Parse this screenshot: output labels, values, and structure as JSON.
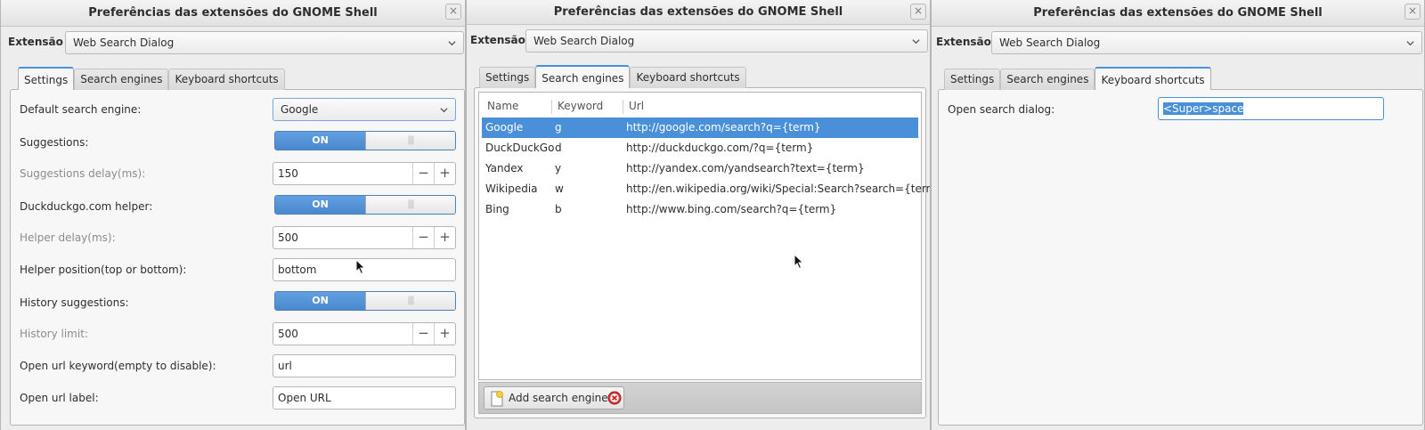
{
  "window": {
    "title": "Preferências das extensões do GNOME Shell",
    "close_glyph": "×",
    "extension_label": "Extensão",
    "extension_value": "Web Search Dialog"
  },
  "tabs": {
    "settings": "Settings",
    "search_engines": "Search engines",
    "keyboard_shortcuts": "Keyboard shortcuts"
  },
  "settings": {
    "default_engine": {
      "label": "Default search engine:",
      "value": "Google"
    },
    "suggestions": {
      "label": "Suggestions:",
      "state": "ON"
    },
    "suggestions_delay": {
      "label": "Suggestions delay(ms):",
      "value": "150"
    },
    "ddg_helper": {
      "label": "Duckduckgo.com helper:",
      "state": "ON"
    },
    "helper_delay": {
      "label": "Helper delay(ms):",
      "value": "500"
    },
    "helper_position": {
      "label": "Helper position(top or bottom):",
      "value": "bottom"
    },
    "history_suggestions": {
      "label": "History suggestions:",
      "state": "ON"
    },
    "history_limit": {
      "label": "History limit:",
      "value": "500"
    },
    "open_url_keyword": {
      "label": "Open url keyword(empty to disable):",
      "value": "url"
    },
    "open_url_label": {
      "label": "Open url label:",
      "value": "Open URL"
    },
    "switch_knob_glyph": "|||",
    "spin_minus": "−",
    "spin_plus": "+"
  },
  "engines": {
    "columns": {
      "name": "Name",
      "keyword": "Keyword",
      "url": "Url"
    },
    "rows": [
      {
        "name": "Google",
        "keyword": "g",
        "url": "http://google.com/search?q={term}"
      },
      {
        "name": "DuckDuckGo",
        "keyword": "d",
        "url": "http://duckduckgo.com/?q={term}"
      },
      {
        "name": "Yandex",
        "keyword": "y",
        "url": "http://yandex.com/yandsearch?text={term}"
      },
      {
        "name": "Wikipedia",
        "keyword": "w",
        "url": "http://en.wikipedia.org/wiki/Special:Search?search={term}"
      },
      {
        "name": "Bing",
        "keyword": "b",
        "url": "http://www.bing.com/search?q={term}"
      }
    ],
    "selected_index": 0,
    "add_button": "Add search engine"
  },
  "shortcuts": {
    "open_dialog": {
      "label": "Open search dialog:",
      "value": "<Super>space"
    }
  },
  "colors": {
    "accent": "#4a90d9",
    "selection_text": "#ffffff"
  },
  "icons": [
    "close-icon",
    "chevron-down-icon",
    "add-document-icon",
    "remove-icon",
    "mouse-pointer-icon"
  ]
}
